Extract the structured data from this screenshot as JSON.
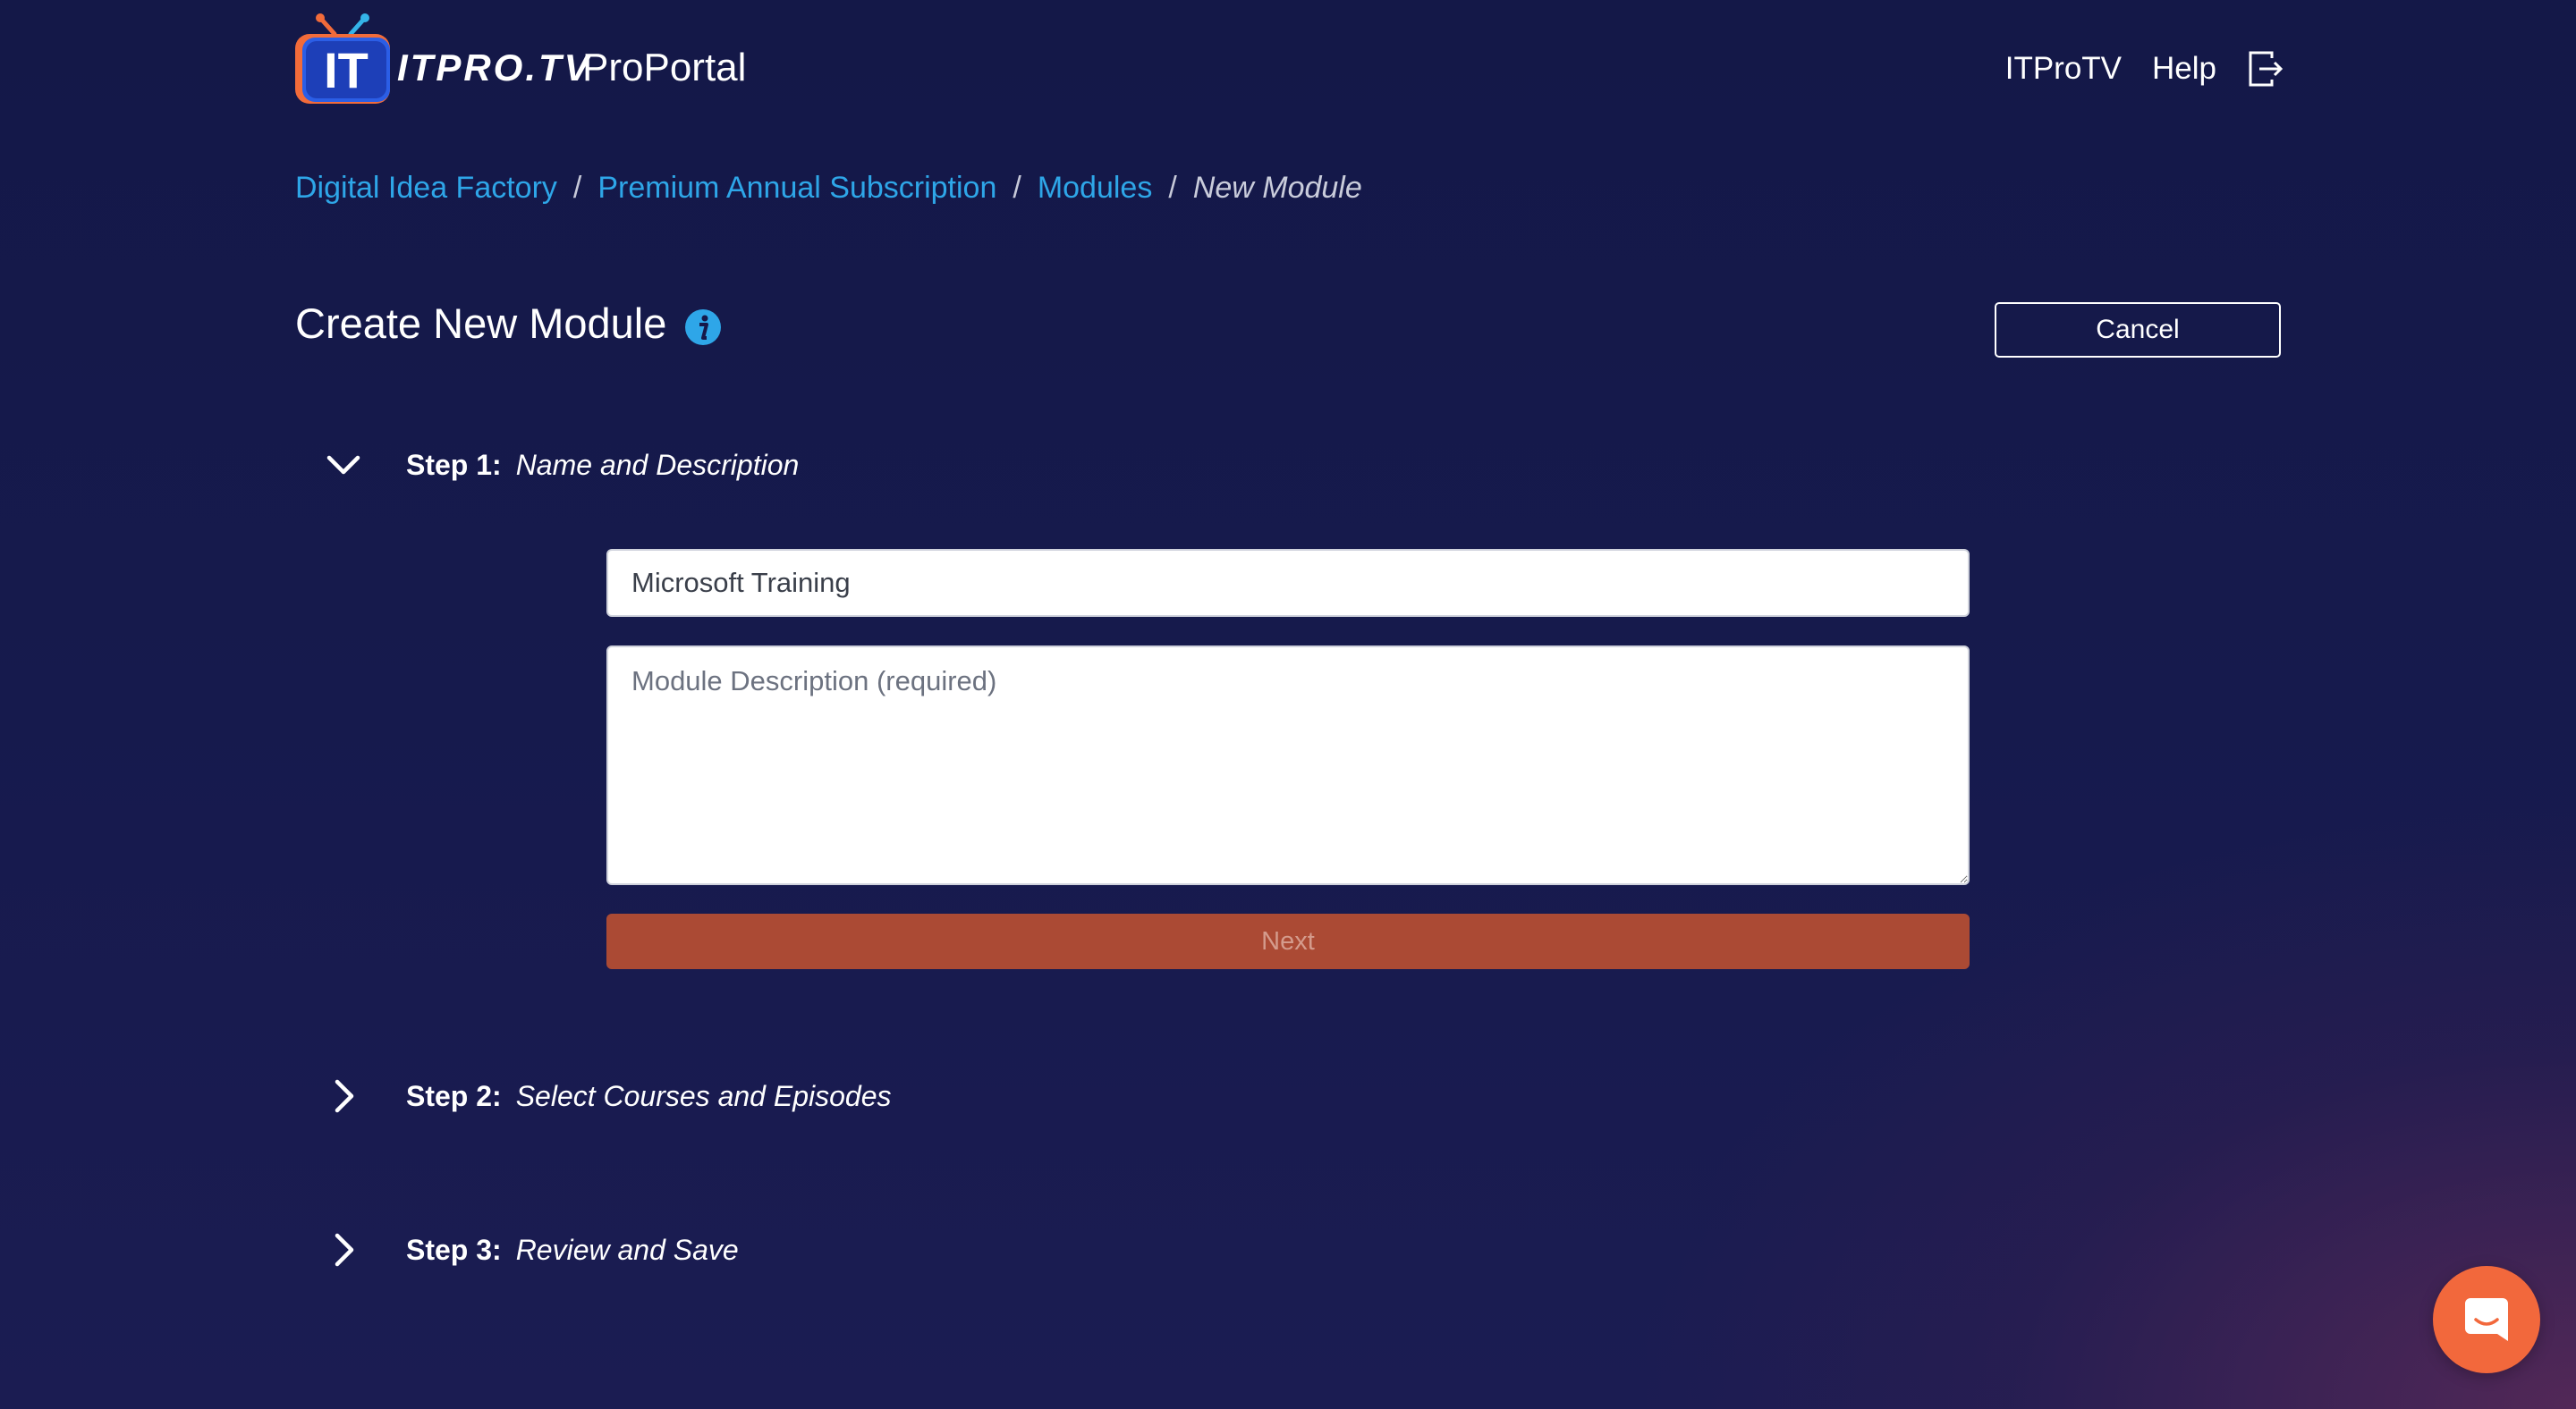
{
  "header": {
    "logo_icon": "itprotv-tv-logo-icon",
    "brand_word": "ITPRO.TV",
    "brand_product": "ProPortal",
    "nav_links": [
      "ITProTV",
      "Help"
    ],
    "logout_icon": "logout-icon"
  },
  "breadcrumb": {
    "items": [
      "Digital Idea Factory",
      "Premium Annual Subscription",
      "Modules"
    ],
    "current": "New Module",
    "separator": "/"
  },
  "page": {
    "title": "Create New Module",
    "info_icon": "info-icon",
    "cancel_label": "Cancel"
  },
  "steps": [
    {
      "number": "Step 1:",
      "title": "Name and Description",
      "expanded": true
    },
    {
      "number": "Step 2:",
      "title": "Select Courses and Episodes",
      "expanded": false
    },
    {
      "number": "Step 3:",
      "title": "Review and Save",
      "expanded": false
    }
  ],
  "form": {
    "module_name_value": "Microsoft Training",
    "module_description_value": "",
    "module_description_placeholder": "Module Description (required)",
    "next_label": "Next"
  },
  "chat": {
    "icon": "chat-bubble-icon"
  },
  "colors": {
    "background": "#16194a",
    "link": "#2ea6e8",
    "next_button": "#ab4a34",
    "chat_button": "#f2683c",
    "logo_blue": "#1f4fd1",
    "logo_orange": "#f26b3a"
  }
}
